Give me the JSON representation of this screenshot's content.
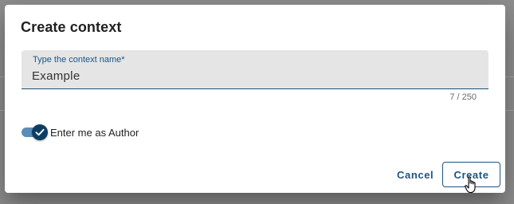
{
  "dialog": {
    "title": "Create context",
    "name_field": {
      "label": "Type the context name*",
      "value": "Example",
      "counter": "7 / 250"
    },
    "author_toggle": {
      "label": "Enter me as Author",
      "checked": true
    },
    "actions": {
      "cancel_label": "Cancel",
      "create_label": "Create"
    }
  },
  "colors": {
    "accent": "#1b5584",
    "toggle_thumb": "#0e3d63",
    "toggle_track": "#5b8db8",
    "field_bg": "#e5e5e5"
  },
  "icons": [
    "check-icon",
    "hand-pointer-cursor-icon"
  ]
}
